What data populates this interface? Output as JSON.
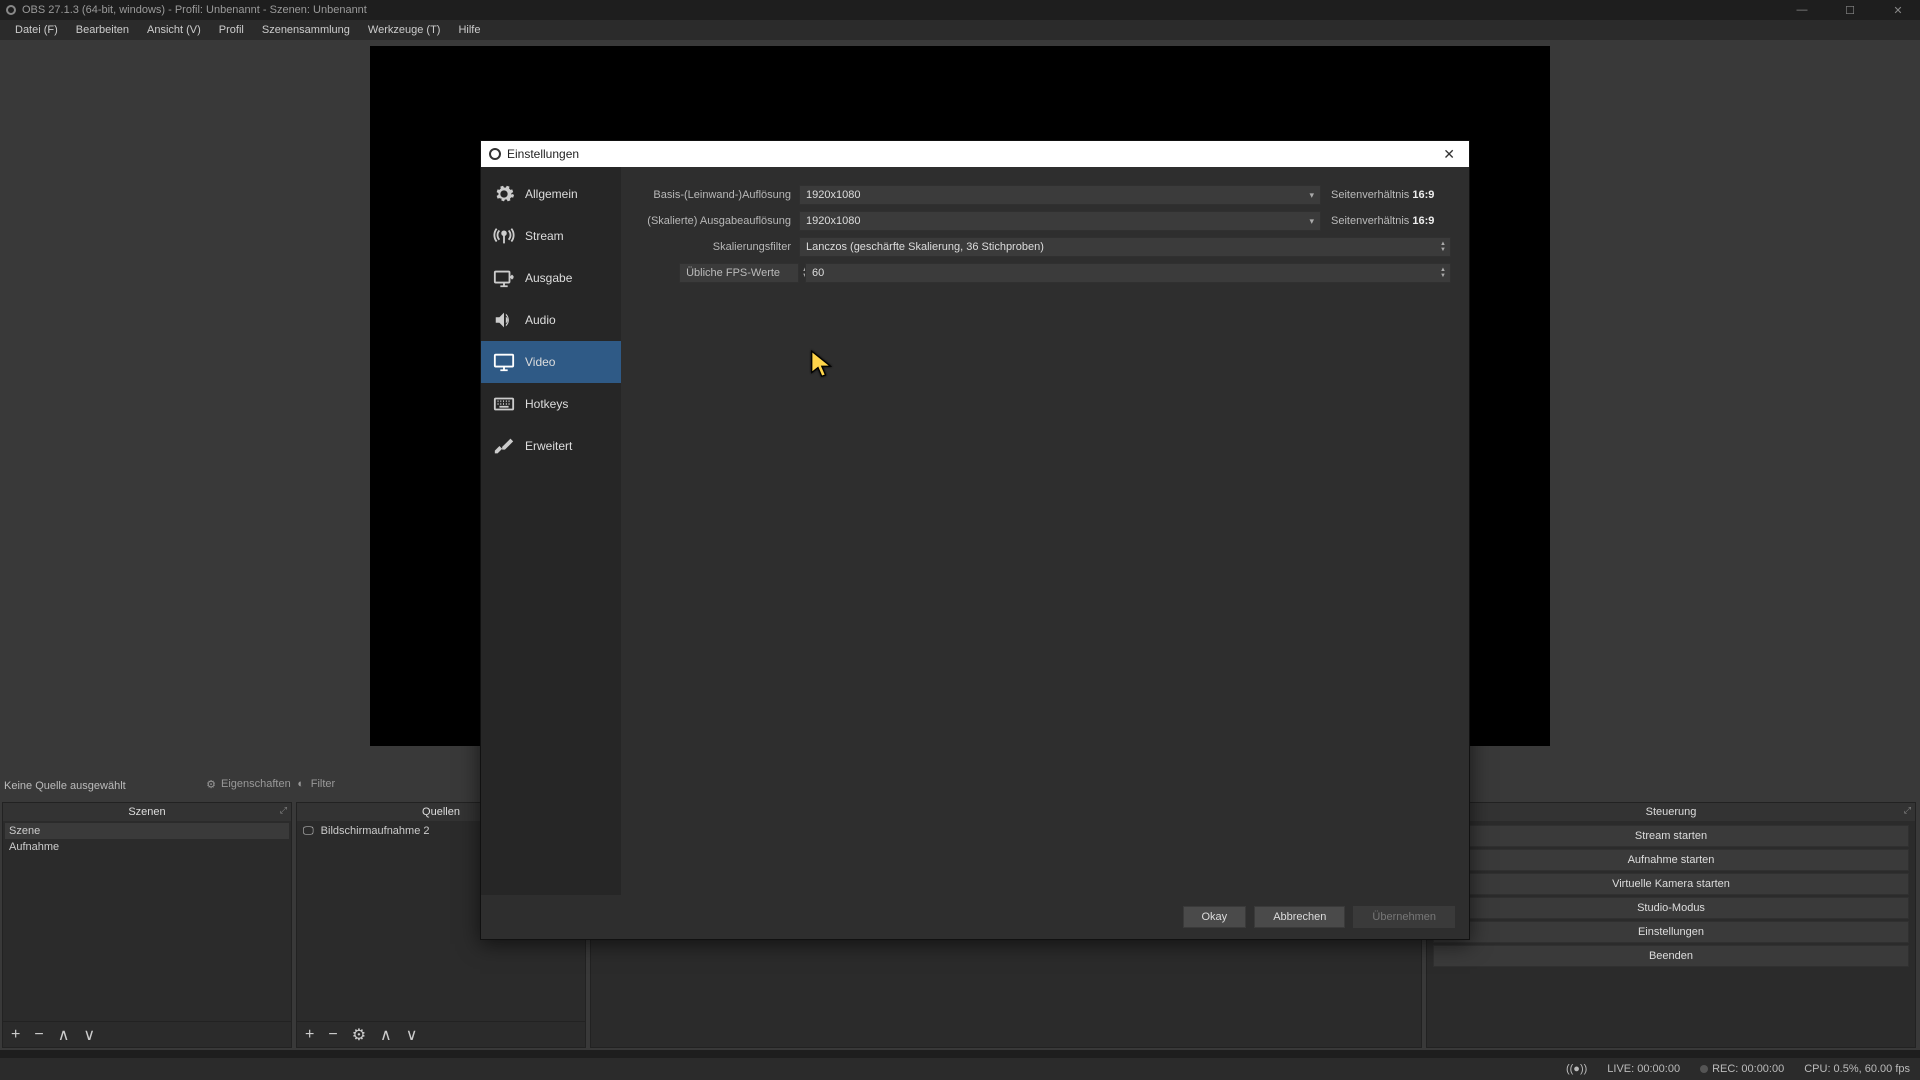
{
  "titlebar": {
    "text": "OBS 27.1.3 (64-bit, windows) - Profil: Unbenannt - Szenen: Unbenannt"
  },
  "menu": [
    "Datei (F)",
    "Bearbeiten",
    "Ansicht (V)",
    "Profil",
    "Szenensammlung",
    "Werkzeuge (T)",
    "Hilfe"
  ],
  "no_source_label": "Keine Quelle ausgewählt",
  "mini": {
    "props": "Eigenschaften",
    "filter": "Filter"
  },
  "docks": {
    "scenes": {
      "title": "Szenen",
      "items": [
        "Szene",
        "Aufnahme"
      ]
    },
    "sources": {
      "title": "Quellen",
      "items": [
        "Bildschirmaufnahme 2"
      ]
    },
    "controls": {
      "title": "Steuerung",
      "buttons": [
        "Stream starten",
        "Aufnahme starten",
        "Virtuelle Kamera starten",
        "Studio-Modus",
        "Einstellungen",
        "Beenden"
      ]
    }
  },
  "status": {
    "live": "LIVE: 00:00:00",
    "rec": "REC: 00:00:00",
    "cpu": "CPU: 0.5%, 60.00 fps"
  },
  "dialog": {
    "title": "Einstellungen",
    "sidebar": [
      {
        "label": "Allgemein",
        "icon": "gear"
      },
      {
        "label": "Stream",
        "icon": "antenna"
      },
      {
        "label": "Ausgabe",
        "icon": "output"
      },
      {
        "label": "Audio",
        "icon": "speaker"
      },
      {
        "label": "Video",
        "icon": "monitor",
        "selected": true
      },
      {
        "label": "Hotkeys",
        "icon": "keyboard"
      },
      {
        "label": "Erweitert",
        "icon": "tools"
      }
    ],
    "video": {
      "base_label": "Basis-(Leinwand-)Auflösung",
      "base_value": "1920x1080",
      "base_aspect_label": "Seitenverhältnis",
      "base_aspect_value": "16:9",
      "out_label": "(Skalierte) Ausgabeauflösung",
      "out_value": "1920x1080",
      "out_aspect_label": "Seitenverhältnis",
      "out_aspect_value": "16:9",
      "filter_label": "Skalierungsfilter",
      "filter_value": "Lanczos (geschärfte Skalierung, 36 Stichproben)",
      "fps_mode_label": "Übliche FPS-Werte",
      "fps_value": "60"
    },
    "buttons": {
      "ok": "Okay",
      "cancel": "Abbrechen",
      "apply": "Übernehmen"
    }
  }
}
